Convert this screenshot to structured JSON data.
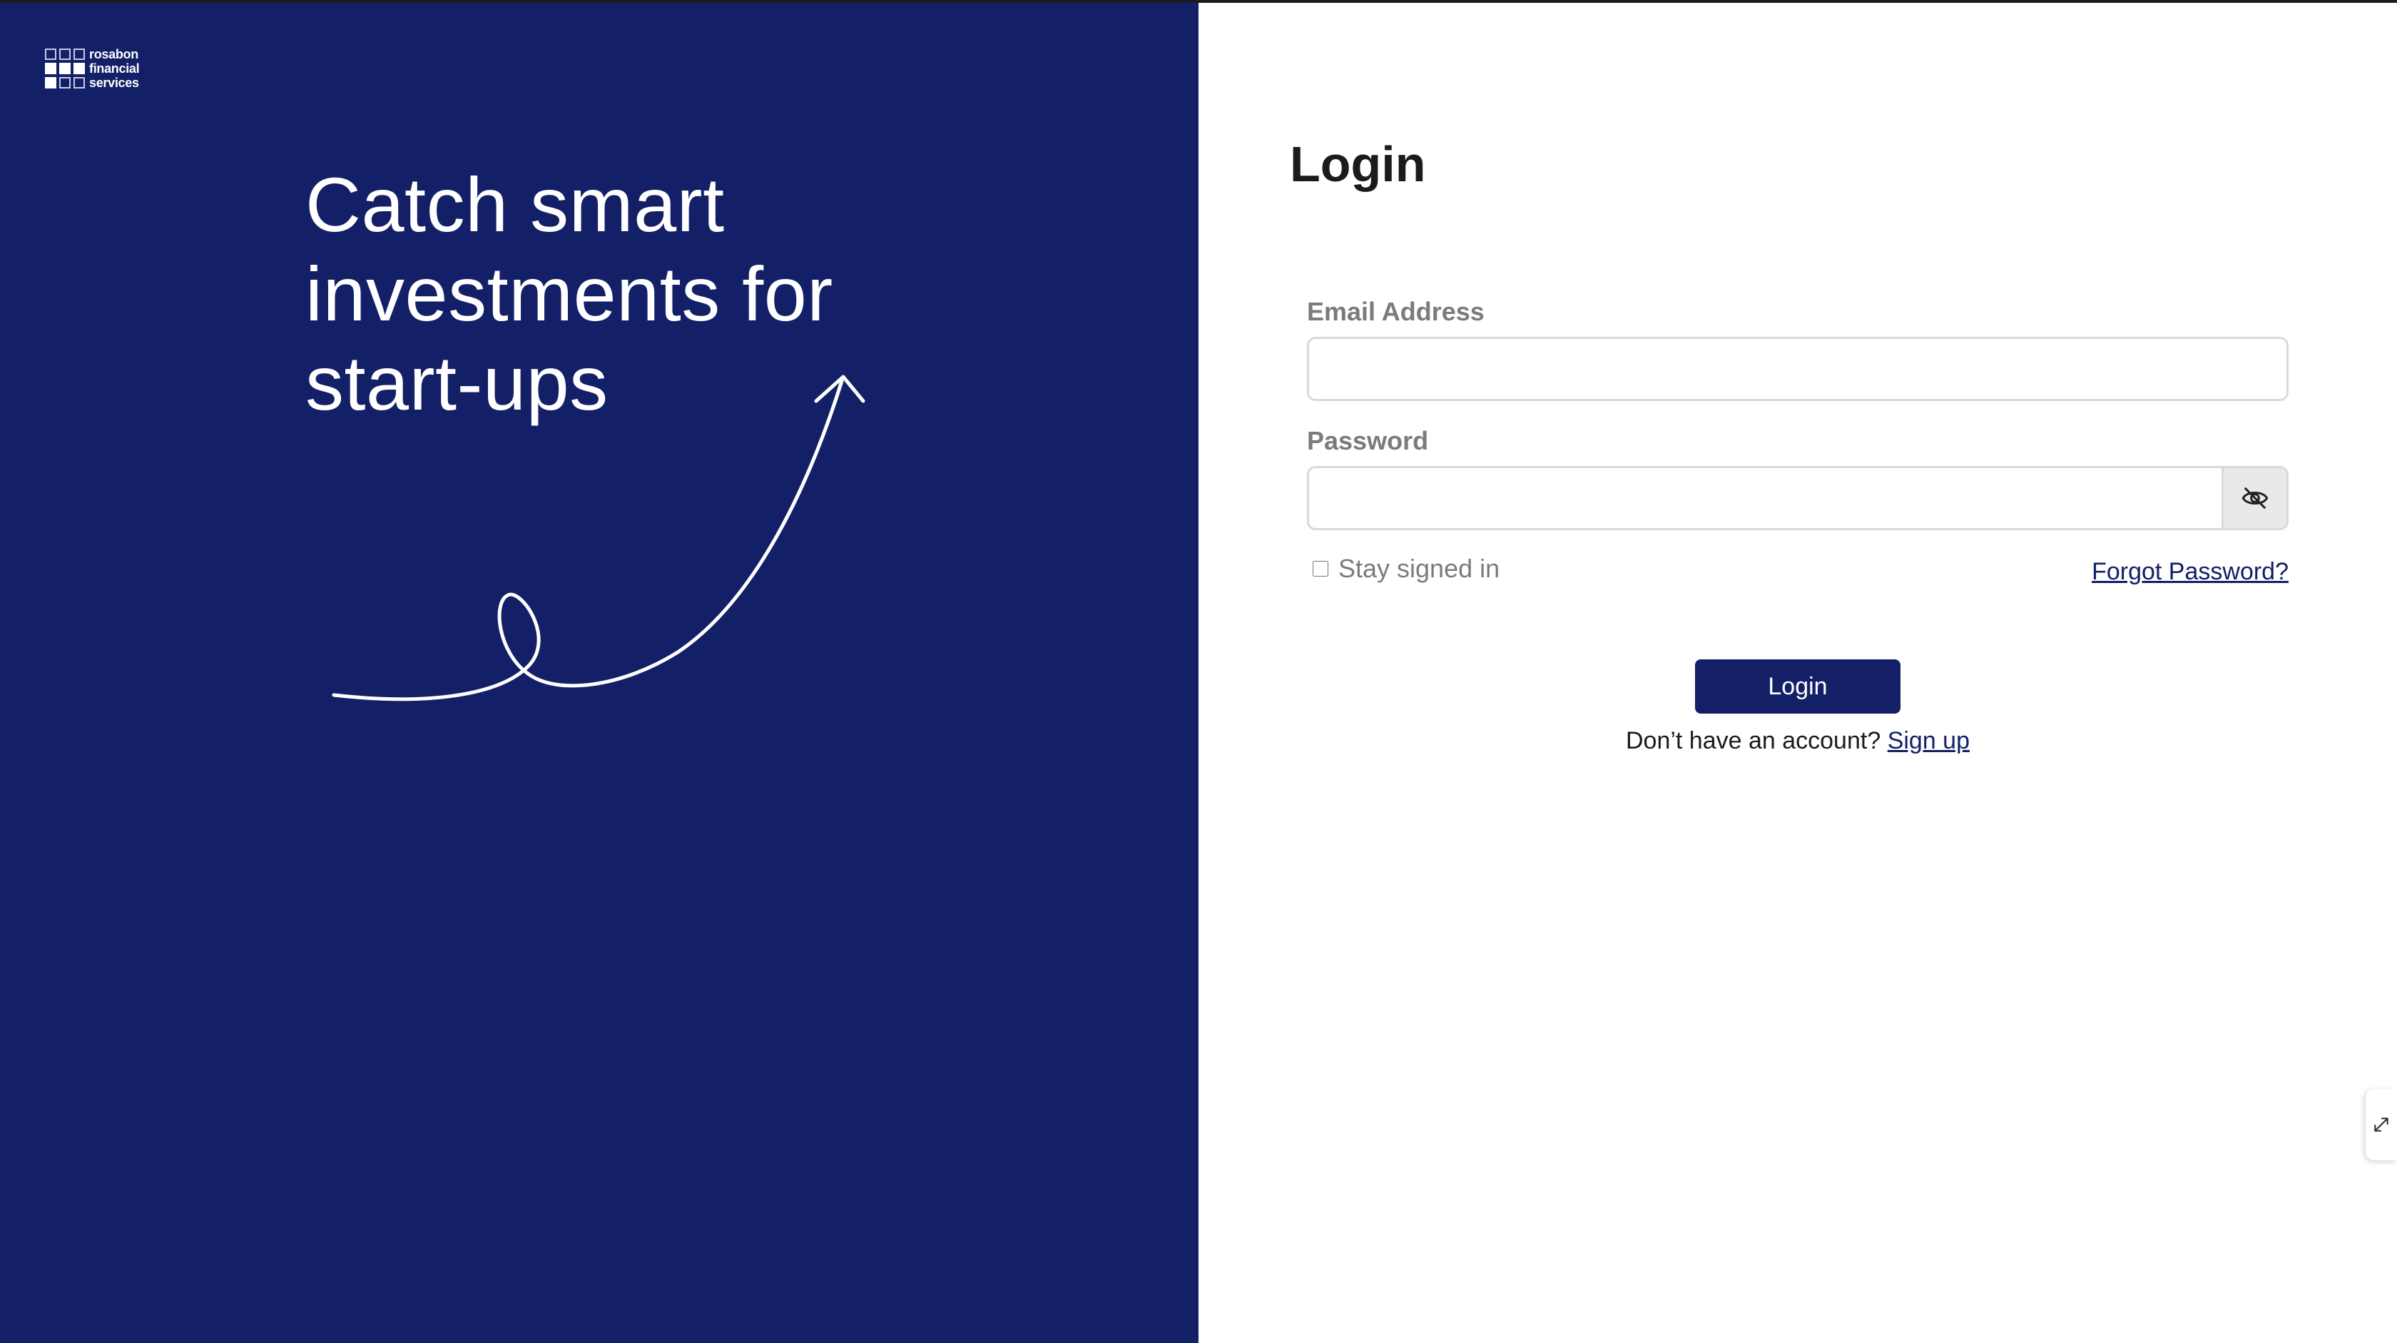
{
  "brand": {
    "logo_lines": [
      "rosabon",
      "financial",
      "services"
    ],
    "logo_icon": "grid-logo-icon",
    "panel_color": "#132067"
  },
  "hero": {
    "headline_lines": [
      "Catch smart",
      "investments for",
      "start-ups"
    ],
    "decoration": "curly-arrow-icon"
  },
  "login": {
    "title": "Login",
    "email_label": "Email Address",
    "email_value": "",
    "password_label": "Password",
    "password_value": "",
    "password_toggle_icon": "eye-off-icon",
    "stay_signed_in_label": "Stay signed in",
    "stay_signed_in_checked": false,
    "forgot_password": "Forgot Password?",
    "submit_label": "Login",
    "signup_prompt": "Don’t have an account?",
    "signup_link": "Sign up"
  },
  "side_widget": {
    "icon": "expand-diagonal-icon"
  },
  "colors": {
    "accent": "#132067",
    "label_gray": "#7b7b7b",
    "text_dark": "#1b1b1b"
  }
}
